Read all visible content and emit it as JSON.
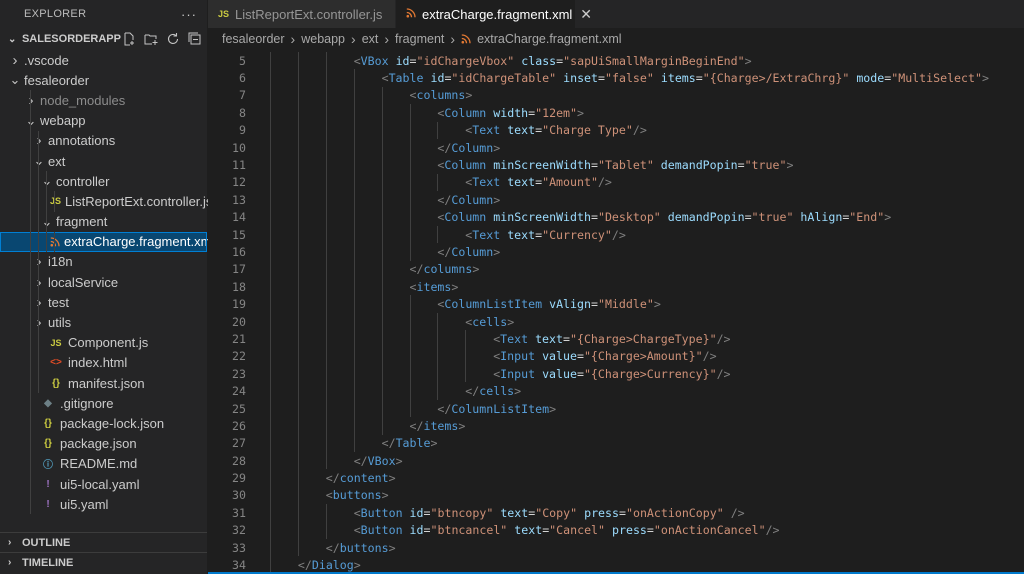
{
  "explorer": {
    "title": "EXPLORER",
    "more": "···",
    "project": "SALESORDERAPP",
    "tree": [
      {
        "label": ".vscode",
        "type": "folder",
        "open": false,
        "depth": 1
      },
      {
        "label": "fesaleorder",
        "type": "folder",
        "open": true,
        "depth": 1
      },
      {
        "label": "node_modules",
        "type": "folder",
        "open": false,
        "depth": 2,
        "dim": true
      },
      {
        "label": "webapp",
        "type": "folder",
        "open": true,
        "depth": 2
      },
      {
        "label": "annotations",
        "type": "folder",
        "open": false,
        "depth": 3
      },
      {
        "label": "ext",
        "type": "folder",
        "open": true,
        "depth": 3
      },
      {
        "label": "controller",
        "type": "folder",
        "open": true,
        "depth": 4
      },
      {
        "label": "ListReportExt.controller.js",
        "type": "js",
        "depth": 5
      },
      {
        "label": "fragment",
        "type": "folder",
        "open": true,
        "depth": 4
      },
      {
        "label": "extraCharge.fragment.xml",
        "type": "xml",
        "depth": 5,
        "selected": true
      },
      {
        "label": "i18n",
        "type": "folder",
        "open": false,
        "depth": 3
      },
      {
        "label": "localService",
        "type": "folder",
        "open": false,
        "depth": 3
      },
      {
        "label": "test",
        "type": "folder",
        "open": false,
        "depth": 3
      },
      {
        "label": "utils",
        "type": "folder",
        "open": false,
        "depth": 3
      },
      {
        "label": "Component.js",
        "type": "js",
        "depth": 3
      },
      {
        "label": "index.html",
        "type": "html",
        "depth": 3
      },
      {
        "label": "manifest.json",
        "type": "json",
        "depth": 3
      },
      {
        "label": ".gitignore",
        "type": "git",
        "depth": 2
      },
      {
        "label": "package-lock.json",
        "type": "json",
        "depth": 2
      },
      {
        "label": "package.json",
        "type": "json",
        "depth": 2
      },
      {
        "label": "README.md",
        "type": "info",
        "depth": 2
      },
      {
        "label": "ui5-local.yaml",
        "type": "yaml",
        "depth": 2
      },
      {
        "label": "ui5.yaml",
        "type": "yaml",
        "depth": 2
      }
    ],
    "outline": "OUTLINE",
    "timeline": "TIMELINE"
  },
  "tabs": [
    {
      "label": "ListReportExt.controller.js",
      "icon": "JS",
      "active": false
    },
    {
      "label": "extraCharge.fragment.xml",
      "icon": "rss",
      "active": true,
      "close": "✕"
    }
  ],
  "breadcrumb": [
    "fesaleorder",
    "webapp",
    "ext",
    "fragment",
    "extraCharge.fragment.xml"
  ],
  "editor": {
    "lines": [
      {
        "n": "5",
        "indent": 3,
        "text": "<VBox id=\"idChargeVbox\" class=\"sapUiSmallMarginBeginEnd\">"
      },
      {
        "n": "6",
        "indent": 4,
        "text": "<Table id=\"idChargeTable\" inset=\"false\" items=\"{Charge>/ExtraChrg}\" mode=\"MultiSelect\">"
      },
      {
        "n": "7",
        "indent": 5,
        "text": "<columns>"
      },
      {
        "n": "8",
        "indent": 6,
        "text": "<Column width=\"12em\">"
      },
      {
        "n": "9",
        "indent": 7,
        "text": "<Text text=\"Charge Type\"/>"
      },
      {
        "n": "10",
        "indent": 6,
        "text": "</Column>"
      },
      {
        "n": "11",
        "indent": 6,
        "text": "<Column minScreenWidth=\"Tablet\" demandPopin=\"true\">"
      },
      {
        "n": "12",
        "indent": 7,
        "text": "<Text text=\"Amount\"/>"
      },
      {
        "n": "13",
        "indent": 6,
        "text": "</Column>"
      },
      {
        "n": "14",
        "indent": 6,
        "text": "<Column minScreenWidth=\"Desktop\" demandPopin=\"true\" hAlign=\"End\">"
      },
      {
        "n": "15",
        "indent": 7,
        "text": "<Text text=\"Currency\"/>"
      },
      {
        "n": "16",
        "indent": 6,
        "text": "</Column>"
      },
      {
        "n": "17",
        "indent": 5,
        "text": "</columns>"
      },
      {
        "n": "18",
        "indent": 5,
        "text": "<items>"
      },
      {
        "n": "19",
        "indent": 6,
        "text": "<ColumnListItem vAlign=\"Middle\">"
      },
      {
        "n": "20",
        "indent": 7,
        "text": "<cells>"
      },
      {
        "n": "21",
        "indent": 8,
        "text": "<Text text=\"{Charge>ChargeType}\"/>"
      },
      {
        "n": "22",
        "indent": 8,
        "text": "<Input value=\"{Charge>Amount}\"/>"
      },
      {
        "n": "23",
        "indent": 8,
        "text": "<Input value=\"{Charge>Currency}\"/>"
      },
      {
        "n": "24",
        "indent": 7,
        "text": "</cells>"
      },
      {
        "n": "25",
        "indent": 6,
        "text": "</ColumnListItem>"
      },
      {
        "n": "26",
        "indent": 5,
        "text": "</items>"
      },
      {
        "n": "27",
        "indent": 4,
        "text": "</Table>"
      },
      {
        "n": "28",
        "indent": 3,
        "text": "</VBox>"
      },
      {
        "n": "29",
        "indent": 2,
        "text": "</content>"
      },
      {
        "n": "30",
        "indent": 2,
        "text": "<buttons>"
      },
      {
        "n": "31",
        "indent": 3,
        "text": "<Button id=\"btncopy\" text=\"Copy\" press=\"onActionCopy\" />"
      },
      {
        "n": "32",
        "indent": 3,
        "text": "<Button id=\"btncancel\" text=\"Cancel\" press=\"onActionCancel\"/>"
      },
      {
        "n": "33",
        "indent": 2,
        "text": "</buttons>"
      },
      {
        "n": "34",
        "indent": 1,
        "text": "</Dialog>"
      }
    ]
  },
  "colors": {
    "tag": "#569cd6",
    "attr": "#9cdcfe",
    "value": "#ce9178",
    "bracket": "#808080",
    "selection": "#094771"
  }
}
